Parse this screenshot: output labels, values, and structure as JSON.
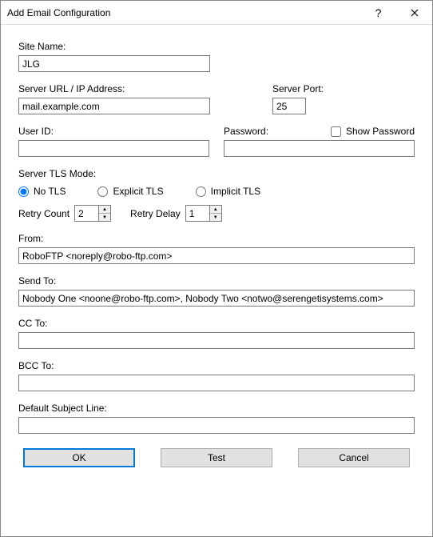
{
  "window": {
    "title": "Add Email Configuration"
  },
  "labels": {
    "site_name": "Site Name:",
    "server_url": "Server URL / IP Address:",
    "server_port": "Server Port:",
    "user_id": "User ID:",
    "password": "Password:",
    "show_password": "Show Password",
    "tls_mode": "Server TLS Mode:",
    "no_tls": "No TLS",
    "explicit_tls": "Explicit TLS",
    "implicit_tls": "Implicit TLS",
    "retry_count": "Retry Count",
    "retry_delay": "Retry Delay",
    "from": "From:",
    "send_to": "Send To:",
    "cc_to": "CC To:",
    "bcc_to": "BCC To:",
    "default_subject": "Default Subject Line:"
  },
  "values": {
    "site_name": "JLG",
    "server_url": "mail.example.com",
    "server_port": "25",
    "user_id": "",
    "password": "",
    "show_password": false,
    "tls_mode": "no_tls",
    "retry_count": "2",
    "retry_delay": "1",
    "from": "RoboFTP <noreply@robo-ftp.com>",
    "send_to": "Nobody One <noone@robo-ftp.com>, Nobody Two <notwo@serengetisystems.com>",
    "cc_to": "",
    "bcc_to": "",
    "default_subject": ""
  },
  "buttons": {
    "ok": "OK",
    "test": "Test",
    "cancel": "Cancel"
  }
}
